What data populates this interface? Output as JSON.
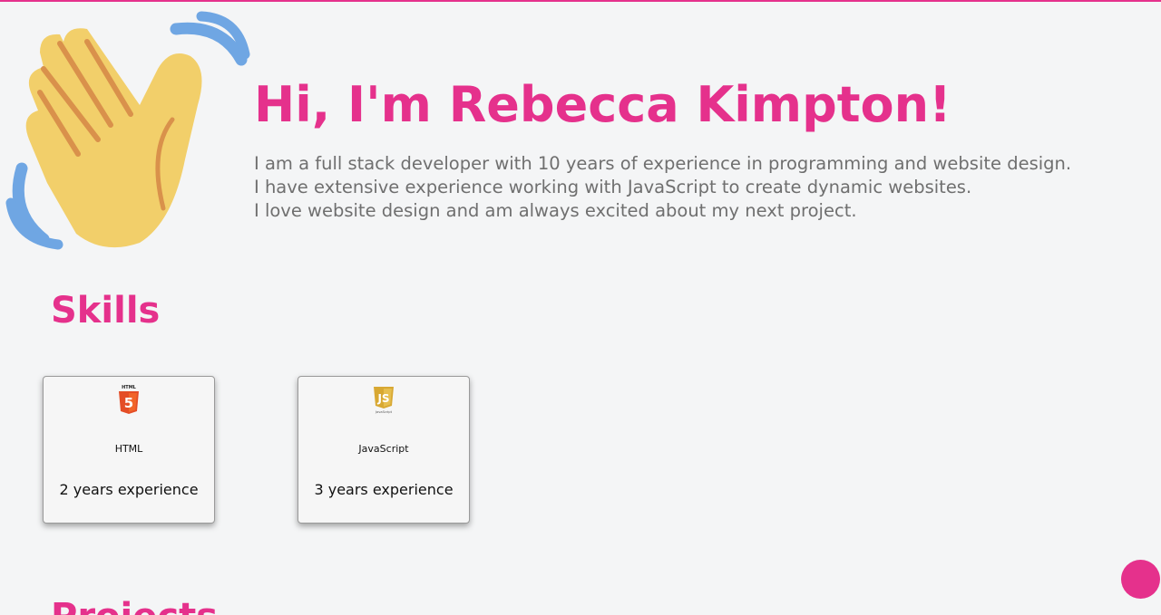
{
  "hero": {
    "title": "Hi, I'm Rebecca Kimpton!",
    "bio_lines": [
      "I am a full stack developer with 10 years of experience in programming and website design.",
      "I have extensive experience working with JavaScript to create dynamic websites.",
      "I love website design and am always excited about my next project."
    ],
    "icon": "waving-hand-icon"
  },
  "skills": {
    "title": "Skills",
    "items": [
      {
        "icon": "html5-logo-icon",
        "logo_text": "HTML",
        "name": "HTML",
        "experience": "2 years experience"
      },
      {
        "icon": "javascript-logo-icon",
        "logo_text": "JavaScript",
        "name": "JavaScript",
        "experience": "3 years experience"
      }
    ]
  },
  "projects": {
    "title": "Projects"
  },
  "colors": {
    "accent": "#e5318c",
    "body_text": "#6f6f6f",
    "background": "#f4f5f6"
  }
}
